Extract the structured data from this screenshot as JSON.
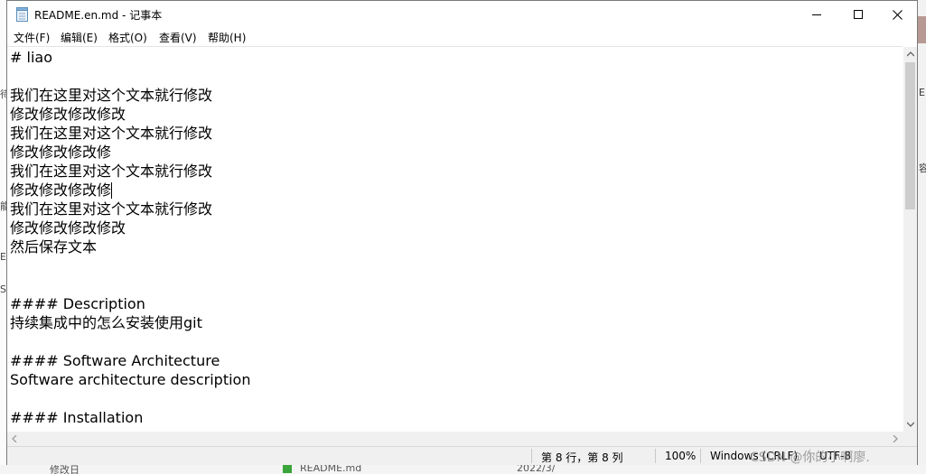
{
  "window": {
    "title": "README.en.md - 记事本",
    "controls": {
      "minimize": "minimize-icon",
      "maximize": "maximize-icon",
      "close": "close-icon"
    }
  },
  "menu": [
    {
      "label": "文件(F)"
    },
    {
      "label": "编辑(E)"
    },
    {
      "label": "格式(O)"
    },
    {
      "label": "查看(V)"
    },
    {
      "label": "帮助(H)"
    }
  ],
  "editor": {
    "lines": [
      "# liao",
      "",
      "我们在这里对这个文本就行修改",
      "修改修改修改修改",
      "我们在这里对这个文本就行修改",
      "修改修改修改修",
      "我们在这里对这个文本就行修改",
      "修改修改修改修",
      "我们在这里对这个文本就行修改",
      "修改修改修改修改",
      "然后保存文本",
      "",
      "",
      "#### Description",
      "持续集成中的怎么安装使用git",
      "",
      "#### Software Architecture",
      "Software architecture description",
      "",
      "#### Installation"
    ]
  },
  "statusbar": {
    "position": "第 8 行，第 8 列",
    "zoom": "100%",
    "line_ending": "Windows (CRLF)",
    "encoding": "UTF-8"
  },
  "watermark": "CSDN @你的小啊廖.",
  "background": {
    "right_fragments": [
      "E",
      "容"
    ],
    "left_fragments": [
      "待",
      "能",
      "E",
      "S"
    ],
    "bottom_fragments": [
      "修改日",
      "README.md",
      "2022/3/"
    ]
  }
}
